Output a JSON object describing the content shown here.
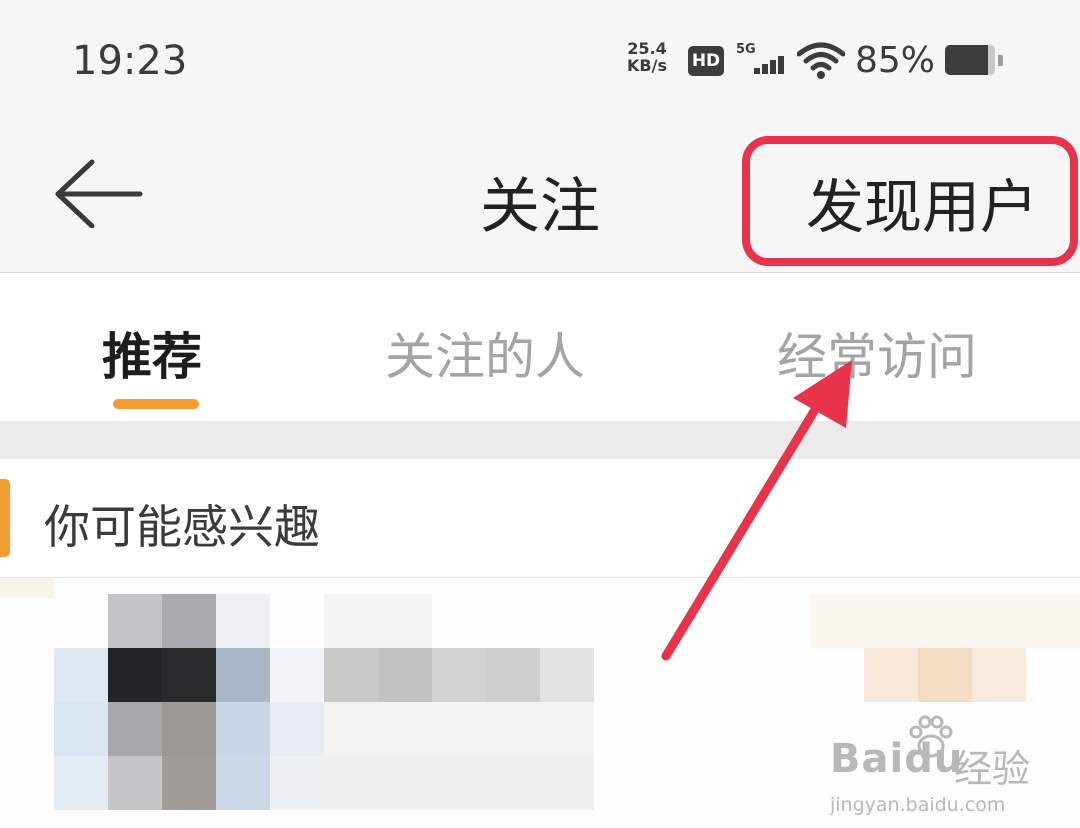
{
  "status_bar": {
    "time": "19:23",
    "speed_value": "25.4",
    "speed_unit": "KB/s",
    "hd_badge": "HD",
    "network_type": "5G",
    "battery_percent": "85%",
    "battery_level": 0.85,
    "icons": [
      "hd-icon",
      "signal-5g-icon",
      "wifi-icon",
      "battery-icon"
    ]
  },
  "nav": {
    "back_icon": "back-arrow-icon",
    "title": "关注",
    "discover_label": "发现用户"
  },
  "tabs": [
    {
      "label": "推荐",
      "active": true
    },
    {
      "label": "关注的人",
      "active": false
    },
    {
      "label": "经常访问",
      "active": false
    }
  ],
  "section": {
    "title": "你可能感兴趣"
  },
  "colors": {
    "accent_orange": "#f39c32",
    "annotation_red": "#e8344b"
  },
  "watermark": {
    "logo": "Baidu",
    "logo_cn": "经验",
    "url": "jingyan.baidu.com"
  }
}
